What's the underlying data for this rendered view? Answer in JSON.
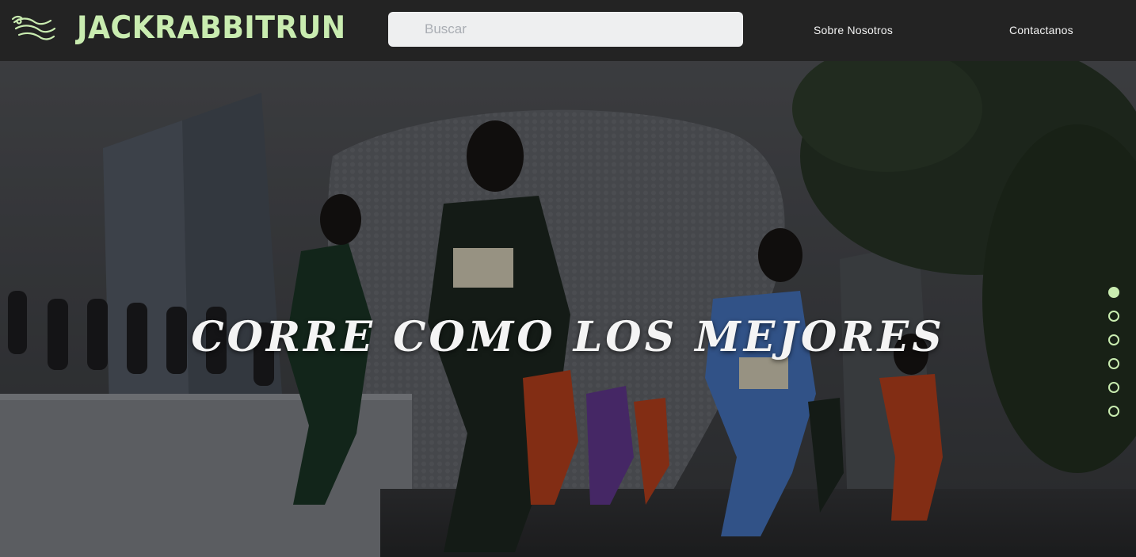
{
  "header": {
    "logo_icon": "rabbit-logo-icon",
    "brand": "JACKRABBITRUN",
    "search": {
      "placeholder": "Buscar",
      "value": ""
    },
    "nav": {
      "about": "Sobre Nosotros",
      "contact": "Contactanos"
    }
  },
  "hero": {
    "title": "CORRE COMO LOS MEJORES",
    "slider": {
      "total": 6,
      "active": 1
    }
  },
  "colors": {
    "accent": "#c9ecb0",
    "navbar": "#232323",
    "search_bg": "#eeeff0"
  }
}
